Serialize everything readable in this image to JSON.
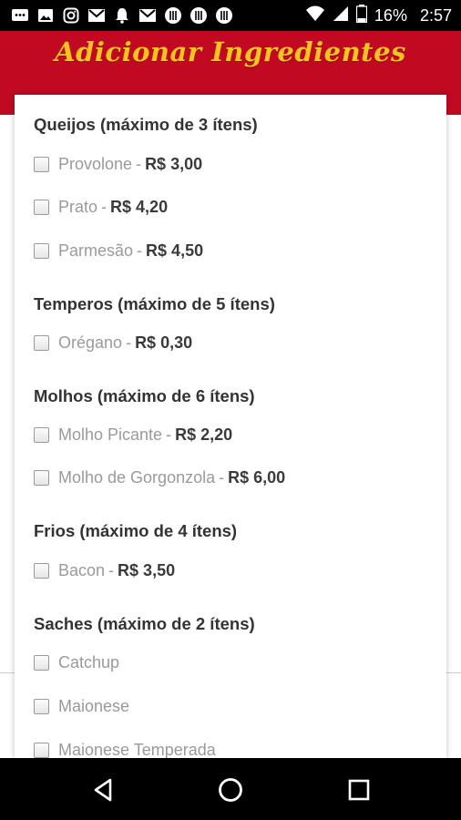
{
  "status_bar": {
    "battery_percent": "16%",
    "time": "2:57",
    "left_icons": [
      "messages-icon",
      "image-icon",
      "instagram-icon",
      "gmail-icon",
      "notification-bell-icon",
      "gmail-icon",
      "app-icon",
      "app-icon",
      "app-icon"
    ],
    "right_icons": [
      "wifi-icon",
      "signal-icon",
      "battery-icon"
    ]
  },
  "header": {
    "title": "Adicionar Ingredientes",
    "accent_color": "#c10a22",
    "title_color": "#f6c321"
  },
  "groups": [
    {
      "title": "Queijos (máximo de 3 ítens)",
      "options": [
        {
          "name": "Provolone",
          "price": "R$ 3,00"
        },
        {
          "name": "Prato",
          "price": "R$ 4,20"
        },
        {
          "name": "Parmesão",
          "price": "R$ 4,50"
        }
      ]
    },
    {
      "title": "Temperos (máximo de 5 ítens)",
      "options": [
        {
          "name": "Orégano",
          "price": "R$ 0,30"
        }
      ]
    },
    {
      "title": "Molhos (máximo de 6 ítens)",
      "options": [
        {
          "name": "Molho Picante",
          "price": "R$ 2,20"
        },
        {
          "name": "Molho de Gorgonzola",
          "price": "R$ 6,00"
        }
      ]
    },
    {
      "title": "Frios (máximo de 4 ítens)",
      "options": [
        {
          "name": "Bacon",
          "price": "R$ 3,50"
        }
      ]
    },
    {
      "title": "Saches (máximo de 2 ítens)",
      "options": [
        {
          "name": "Catchup",
          "price": ""
        },
        {
          "name": "Maionese",
          "price": ""
        },
        {
          "name": "Maionese Temperada",
          "price": ""
        }
      ]
    }
  ],
  "price_separator": "-",
  "nav_bar": {
    "buttons": [
      "back-icon",
      "home-icon",
      "recents-icon"
    ]
  }
}
